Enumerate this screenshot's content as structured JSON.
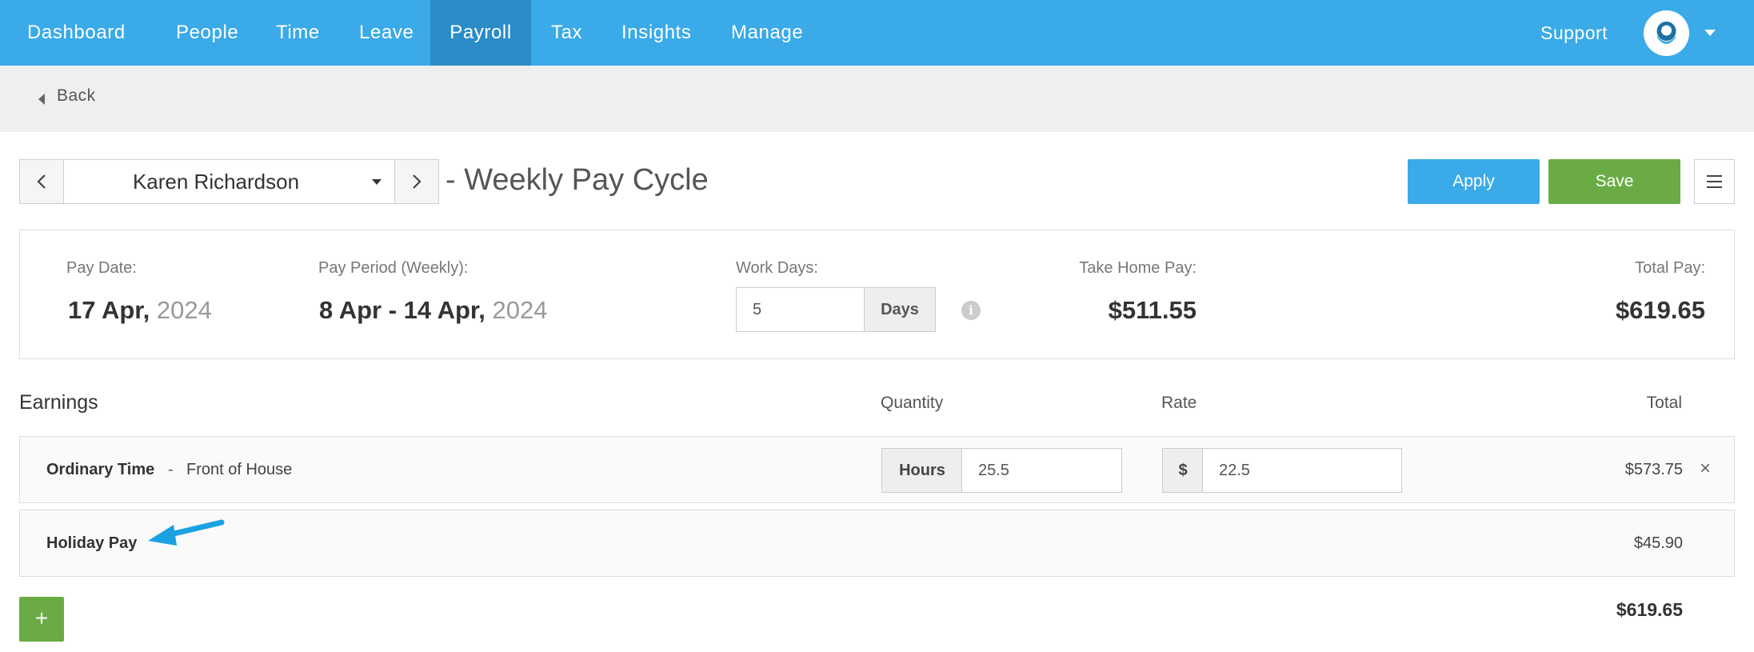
{
  "nav": {
    "items": [
      {
        "label": "Dashboard"
      },
      {
        "label": "People"
      },
      {
        "label": "Time"
      },
      {
        "label": "Leave"
      },
      {
        "label": "Payroll",
        "active": true
      },
      {
        "label": "Tax"
      },
      {
        "label": "Insights"
      },
      {
        "label": "Manage"
      }
    ],
    "support_label": "Support",
    "avatar_icon": "user-avatar-icon"
  },
  "backbar": {
    "back_label": "Back"
  },
  "header": {
    "employee_name": "Karen Richardson",
    "cycle_title": "- Weekly Pay Cycle",
    "apply_label": "Apply",
    "save_label": "Save"
  },
  "summary": {
    "pay_date_label": "Pay Date:",
    "pay_date_value": "17 Apr,",
    "pay_date_year": "2024",
    "pay_period_label": "Pay Period (Weekly):",
    "pay_period_value": "8 Apr - 14 Apr,",
    "pay_period_year": "2024",
    "work_days_label": "Work Days:",
    "work_days_value": "5",
    "work_days_unit": "Days",
    "take_home_label": "Take Home Pay:",
    "take_home_value": "$511.55",
    "total_pay_label": "Total Pay:",
    "total_pay_value": "$619.65"
  },
  "earnings": {
    "title": "Earnings",
    "col_quantity": "Quantity",
    "col_rate": "Rate",
    "col_total": "Total",
    "rows": [
      {
        "label": "Ordinary Time",
        "separator": "-",
        "department": "Front of House",
        "quantity_unit": "Hours",
        "quantity_value": "25.5",
        "rate_unit": "$",
        "rate_value": "22.5",
        "total": "$573.75"
      },
      {
        "label": "Holiday Pay",
        "total": "$45.90"
      }
    ],
    "add_label": "+",
    "grand_total": "$619.65"
  },
  "colors": {
    "nav_bg": "#3aaae8",
    "nav_active": "#2b8cc8",
    "apply": "#3aaae8",
    "save": "#6aab45",
    "annotation_arrow": "#1ba1e2"
  }
}
